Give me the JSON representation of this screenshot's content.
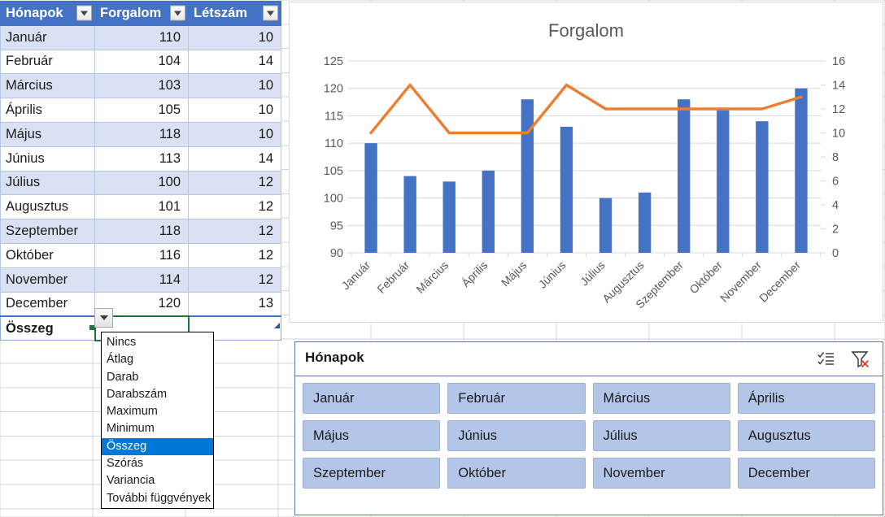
{
  "table": {
    "headers": [
      "Hónapok",
      "Forgalom",
      "Létszám"
    ],
    "rows": [
      {
        "month": "Január",
        "forgalom": "110",
        "letszam": "10"
      },
      {
        "month": "Február",
        "forgalom": "104",
        "letszam": "14"
      },
      {
        "month": "Március",
        "forgalom": "103",
        "letszam": "10"
      },
      {
        "month": "Április",
        "forgalom": "105",
        "letszam": "10"
      },
      {
        "month": "Május",
        "forgalom": "118",
        "letszam": "10"
      },
      {
        "month": "Június",
        "forgalom": "113",
        "letszam": "14"
      },
      {
        "month": "Július",
        "forgalom": "100",
        "letszam": "12"
      },
      {
        "month": "Augusztus",
        "forgalom": "101",
        "letszam": "12"
      },
      {
        "month": "Szeptember",
        "forgalom": "118",
        "letszam": "12"
      },
      {
        "month": "Október",
        "forgalom": "116",
        "letszam": "12"
      },
      {
        "month": "November",
        "forgalom": "114",
        "letszam": "12"
      },
      {
        "month": "December",
        "forgalom": "120",
        "letszam": "13"
      }
    ],
    "total_row": {
      "label": "Összeg",
      "forgalom_value": "",
      "letszam_value": ""
    },
    "header_fill": "#4472C4",
    "banded_fill": "#D9E1F2"
  },
  "dropdown": {
    "selected": "Összeg",
    "highlight_color": "#0078D7",
    "items": [
      "Nincs",
      "Átlag",
      "Darab",
      "Darabszám",
      "Maximum",
      "Minimum",
      "Összeg",
      "Szórás",
      "Variancia",
      "További függvények"
    ]
  },
  "slicer": {
    "title": "Hónapok",
    "multiselect_icon": "multi-select-icon",
    "clear_filter_icon": "clear-filter-icon",
    "button_fill": "#B4C6E7",
    "items": [
      "Január",
      "Február",
      "Március",
      "Április",
      "Május",
      "Június",
      "Július",
      "Augusztus",
      "Szeptember",
      "Október",
      "November",
      "December"
    ]
  },
  "chart_data": {
    "type": "bar",
    "title": "Forgalom",
    "xlabel": "",
    "ylabel": "",
    "grid": true,
    "legend": false,
    "categories": [
      "Január",
      "Február",
      "Március",
      "Április",
      "Május",
      "Június",
      "Július",
      "Augusztus",
      "Szeptember",
      "Október",
      "November",
      "December"
    ],
    "xtick_rotation": -45,
    "series": [
      {
        "name": "Forgalom",
        "type": "bar",
        "axis": "primary",
        "color": "#4472C4",
        "values": [
          110,
          104,
          103,
          105,
          118,
          113,
          100,
          101,
          118,
          116,
          114,
          120
        ]
      },
      {
        "name": "Létszám",
        "type": "line",
        "axis": "secondary",
        "color": "#ED7D31",
        "values": [
          10,
          14,
          10,
          10,
          10,
          14,
          12,
          12,
          12,
          12,
          12,
          13
        ]
      }
    ],
    "primary_axis": {
      "min": 90,
      "max": 125,
      "step": 5,
      "ticks": [
        90,
        95,
        100,
        105,
        110,
        115,
        120,
        125
      ]
    },
    "secondary_axis": {
      "min": 0,
      "max": 16,
      "step": 2,
      "ticks": [
        0,
        2,
        4,
        6,
        8,
        10,
        12,
        14,
        16
      ]
    }
  }
}
